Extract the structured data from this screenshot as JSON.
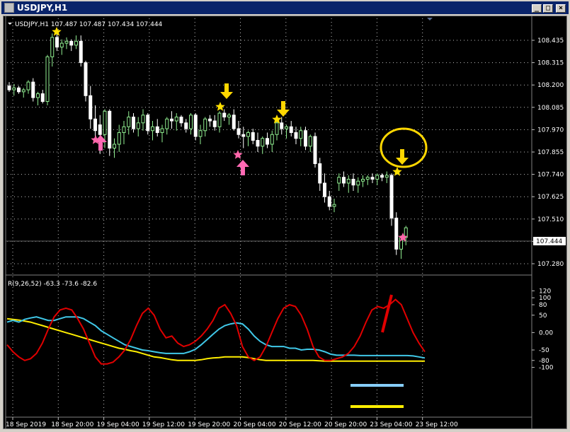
{
  "window": {
    "title": "USDJPY,H1",
    "min_label": "_",
    "max_label": "□",
    "close_label": "×"
  },
  "chart": {
    "header": "USDJPY,H1  107.487 107.487 107.434 107.444",
    "current_price_label": "107.444",
    "price_ticks": [
      "108.435",
      "108.315",
      "108.200",
      "108.085",
      "107.970",
      "107.855",
      "107.740",
      "107.625",
      "107.510",
      "107.395",
      "107.280"
    ],
    "indicator_header": "R(9,26,52) -63.3 -73.6 -82.6",
    "indicator_ticks": [
      "120",
      "100",
      "80",
      "50",
      "0.00",
      "-50",
      "-80",
      "-100"
    ],
    "time_labels": [
      "18 Sep 2019",
      "18 Sep 20:00",
      "19 Sep 04:00",
      "19 Sep 12:00",
      "19 Sep 20:00",
      "20 Sep 04:00",
      "20 Sep 12:00",
      "20 Sep 20:00",
      "23 Sep 04:00",
      "23 Sep 12:00"
    ],
    "colors": {
      "bull": "#90ee90",
      "bear": "#ffffff",
      "red_line": "#e00000",
      "cyan_line": "#40c8e8",
      "yellow_line": "#ffee00",
      "star_yellow": "#ffe000",
      "star_pink": "#ff66aa",
      "arrow_yellow": "#ffd700",
      "arrow_pink": "#ff69b4"
    },
    "candles": [
      [
        108.2,
        108.22,
        108.17,
        108.18
      ],
      [
        108.18,
        108.21,
        108.15,
        108.19
      ],
      [
        108.19,
        108.2,
        108.16,
        108.17
      ],
      [
        108.17,
        108.19,
        108.14,
        108.18
      ],
      [
        108.18,
        108.23,
        108.16,
        108.22
      ],
      [
        108.22,
        108.24,
        108.12,
        108.14
      ],
      [
        108.14,
        108.17,
        108.1,
        108.16
      ],
      [
        108.16,
        108.18,
        108.11,
        108.12
      ],
      [
        108.12,
        108.36,
        108.1,
        108.35
      ],
      [
        108.35,
        108.47,
        108.3,
        108.45
      ],
      [
        108.45,
        108.47,
        108.38,
        108.4
      ],
      [
        108.4,
        108.44,
        108.36,
        108.42
      ],
      [
        108.42,
        108.45,
        108.39,
        108.43
      ],
      [
        108.43,
        108.44,
        108.38,
        108.41
      ],
      [
        108.41,
        108.46,
        108.39,
        108.43
      ],
      [
        108.43,
        108.46,
        108.3,
        108.32
      ],
      [
        108.32,
        108.33,
        108.12,
        108.15
      ],
      [
        108.15,
        108.2,
        107.98,
        108.03
      ],
      [
        108.03,
        108.1,
        107.92,
        107.97
      ],
      [
        108.0,
        108.05,
        107.85,
        107.95
      ],
      [
        107.95,
        108.08,
        107.88,
        108.07
      ],
      [
        108.07,
        108.08,
        107.84,
        107.88
      ],
      [
        107.88,
        107.93,
        107.83,
        107.9
      ],
      [
        107.9,
        108.0,
        107.86,
        107.96
      ],
      [
        107.96,
        108.02,
        107.9,
        107.99
      ],
      [
        107.99,
        108.07,
        107.95,
        108.04
      ],
      [
        108.04,
        108.06,
        107.96,
        107.98
      ],
      [
        107.98,
        108.04,
        107.94,
        108.01
      ],
      [
        108.01,
        108.08,
        107.97,
        108.05
      ],
      [
        108.05,
        108.06,
        107.95,
        107.97
      ],
      [
        107.97,
        108.02,
        107.92,
        107.99
      ],
      [
        107.99,
        108.03,
        107.94,
        107.96
      ],
      [
        107.96,
        108.0,
        107.91,
        107.98
      ],
      [
        107.98,
        108.04,
        107.95,
        108.03
      ],
      [
        108.03,
        108.07,
        107.98,
        108.02
      ],
      [
        108.02,
        108.06,
        107.97,
        108.04
      ],
      [
        108.04,
        108.05,
        107.99,
        108.01
      ],
      [
        108.01,
        108.03,
        107.96,
        107.98
      ],
      [
        107.98,
        108.06,
        107.95,
        108.05
      ],
      [
        108.05,
        108.06,
        107.92,
        107.94
      ],
      [
        107.94,
        108.0,
        107.9,
        107.97
      ],
      [
        107.97,
        108.04,
        107.94,
        108.03
      ],
      [
        108.03,
        108.05,
        107.99,
        108.02
      ],
      [
        108.02,
        108.05,
        107.97,
        107.99
      ],
      [
        107.99,
        108.07,
        107.96,
        108.06
      ],
      [
        108.06,
        108.08,
        108.02,
        108.04
      ],
      [
        108.04,
        108.06,
        108.0,
        108.05
      ],
      [
        108.05,
        108.08,
        107.97,
        107.98
      ],
      [
        107.98,
        108.02,
        107.93,
        107.95
      ],
      [
        107.95,
        107.99,
        107.88,
        107.94
      ],
      [
        107.94,
        107.97,
        107.89,
        107.96
      ],
      [
        107.96,
        107.98,
        107.9,
        107.92
      ],
      [
        107.92,
        107.96,
        107.86,
        107.89
      ],
      [
        107.89,
        107.94,
        107.85,
        107.93
      ],
      [
        107.93,
        107.96,
        107.88,
        107.9
      ],
      [
        107.9,
        107.97,
        107.86,
        107.95
      ],
      [
        107.95,
        108.03,
        107.92,
        108.01
      ],
      [
        108.01,
        108.04,
        107.95,
        107.98
      ],
      [
        107.98,
        108.0,
        107.93,
        107.99
      ],
      [
        107.99,
        108.02,
        107.94,
        107.96
      ],
      [
        107.96,
        107.99,
        107.9,
        107.93
      ],
      [
        107.93,
        107.99,
        107.89,
        107.97
      ],
      [
        107.97,
        107.99,
        107.87,
        107.89
      ],
      [
        107.89,
        107.95,
        107.86,
        107.94
      ],
      [
        107.94,
        107.96,
        107.78,
        107.8
      ],
      [
        107.8,
        107.83,
        107.66,
        107.7
      ],
      [
        107.7,
        107.75,
        107.6,
        107.63
      ],
      [
        107.63,
        107.66,
        107.56,
        107.58
      ],
      [
        107.58,
        107.62,
        107.55,
        107.59
      ],
      [
        107.7,
        107.75,
        107.66,
        107.73
      ],
      [
        107.73,
        107.76,
        107.68,
        107.7
      ],
      [
        107.7,
        107.74,
        107.65,
        107.72
      ],
      [
        107.72,
        107.75,
        107.66,
        107.69
      ],
      [
        107.69,
        107.73,
        107.65,
        107.71
      ],
      [
        107.71,
        107.74,
        107.68,
        107.72
      ],
      [
        107.72,
        107.74,
        107.69,
        107.73
      ],
      [
        107.73,
        107.75,
        107.7,
        107.72
      ],
      [
        107.72,
        107.75,
        107.69,
        107.74
      ],
      [
        107.74,
        107.75,
        107.71,
        107.73
      ],
      [
        107.73,
        107.76,
        107.7,
        107.74
      ],
      [
        107.74,
        107.75,
        107.48,
        107.52
      ],
      [
        107.52,
        107.55,
        107.33,
        107.36
      ],
      [
        107.36,
        107.43,
        107.31,
        107.42
      ],
      [
        107.42,
        107.48,
        107.38,
        107.47
      ]
    ],
    "red": [
      -35,
      -55,
      -70,
      -80,
      -75,
      -60,
      -30,
      10,
      45,
      65,
      70,
      65,
      40,
      10,
      -30,
      -70,
      -90,
      -90,
      -85,
      -70,
      -50,
      -20,
      20,
      55,
      70,
      50,
      10,
      -15,
      -10,
      -30,
      -40,
      -35,
      -25,
      -10,
      10,
      35,
      70,
      80,
      55,
      20,
      -40,
      -70,
      -80,
      -70,
      -40,
      0,
      40,
      70,
      80,
      75,
      50,
      10,
      -40,
      -70,
      -80,
      -80,
      -75,
      -70,
      -60,
      -40,
      -10,
      30,
      65,
      75,
      70,
      80,
      95,
      80,
      40,
      0,
      -30,
      -55
    ],
    "cyan": [
      30,
      35,
      30,
      38,
      42,
      45,
      40,
      35,
      35,
      40,
      45,
      45,
      45,
      40,
      30,
      20,
      5,
      -5,
      -15,
      -25,
      -35,
      -40,
      -45,
      -50,
      -52,
      -55,
      -58,
      -60,
      -60,
      -60,
      -60,
      -55,
      -48,
      -35,
      -20,
      -5,
      10,
      20,
      25,
      28,
      25,
      10,
      -10,
      -25,
      -35,
      -40,
      -40,
      -40,
      -45,
      -45,
      -50,
      -48,
      -48,
      -50,
      -55,
      -62,
      -65,
      -65,
      -65,
      -65,
      -66,
      -66,
      -66,
      -66,
      -66,
      -66,
      -66,
      -66,
      -66,
      -67,
      -70,
      -73
    ],
    "yellow": [
      40,
      38,
      36,
      33,
      30,
      25,
      20,
      15,
      10,
      5,
      0,
      -5,
      -10,
      -15,
      -20,
      -25,
      -30,
      -35,
      -40,
      -45,
      -48,
      -52,
      -55,
      -60,
      -65,
      -70,
      -72,
      -75,
      -78,
      -80,
      -80,
      -80,
      -80,
      -78,
      -75,
      -73,
      -72,
      -70,
      -70,
      -70,
      -70,
      -72,
      -75,
      -78,
      -80,
      -80,
      -80,
      -80,
      -80,
      -80,
      -80,
      -80,
      -80,
      -81,
      -82,
      -82,
      -82,
      -82,
      -82,
      -82,
      -82,
      -82,
      -82,
      -82,
      -82,
      -82,
      -82,
      -82,
      -82,
      -82,
      -82,
      -82
    ]
  }
}
